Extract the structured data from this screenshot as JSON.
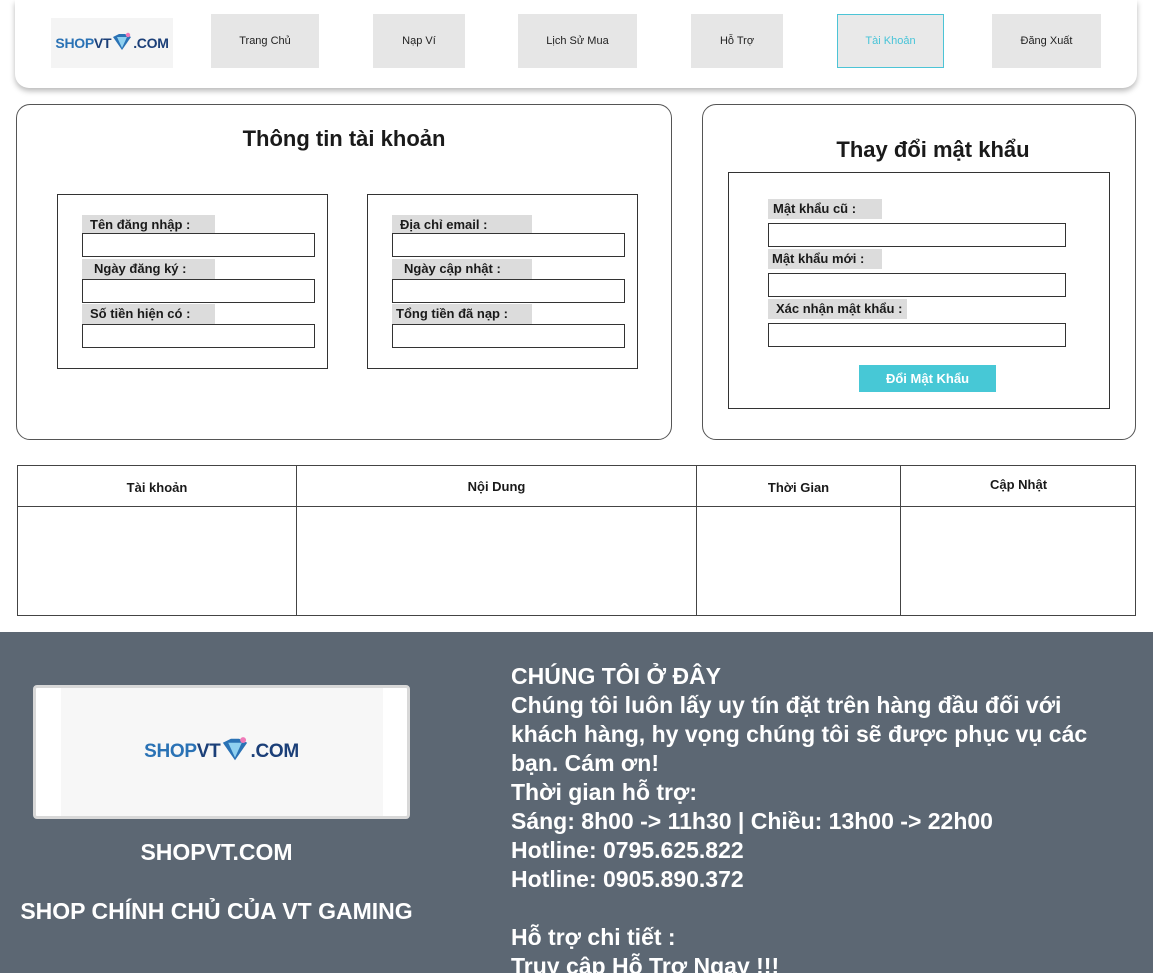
{
  "brand": {
    "logo_shop": "SHOP",
    "logo_vt": "VT",
    "logo_com": ".COM"
  },
  "nav": {
    "items": [
      {
        "label": "Trang Chủ"
      },
      {
        "label": "Nạp Ví"
      },
      {
        "label": "Lịch Sử Mua"
      },
      {
        "label": "Hỗ Trợ"
      },
      {
        "label": "Tài Khoản"
      },
      {
        "label": "Đăng Xuất"
      }
    ],
    "active": "Tài Khoản"
  },
  "account_info": {
    "title": "Thông tin tài khoản",
    "left_fields": [
      {
        "label": "Tên đăng nhập :",
        "value": ""
      },
      {
        "label": "Ngày đăng ký :",
        "value": ""
      },
      {
        "label": "Số tiền hiện có :",
        "value": ""
      }
    ],
    "right_fields": [
      {
        "label": "Địa chỉ email :",
        "value": ""
      },
      {
        "label": "Ngày cập nhật :",
        "value": ""
      },
      {
        "label": "Tổng tiền đã nạp :",
        "value": ""
      }
    ]
  },
  "change_password": {
    "title": "Thay đổi mật khẩu",
    "fields": [
      {
        "label": "Mật khẩu cũ :",
        "value": ""
      },
      {
        "label": "Mật khẩu mới :",
        "value": ""
      },
      {
        "label": "Xác nhận mật khẩu :",
        "value": ""
      }
    ],
    "button_label": "Đổi Mật Khẩu"
  },
  "history_table": {
    "columns": [
      "Tài khoản",
      "Nội Dung",
      "Thời Gian",
      "Cập Nhật"
    ],
    "rows": []
  },
  "footer": {
    "site_name": "SHOPVT.COM",
    "tagline": "SHOP CHÍNH CHỦ CỦA VT GAMING",
    "heading": "CHÚNG TÔI Ở ĐÂY",
    "intro": "Chúng tôi luôn lấy uy tín đặt trên hàng đầu đối với khách hàng, hy vọng chúng tôi sẽ được phục vụ các bạn. Cám ơn!",
    "hours_label": "Thời gian hỗ trợ:",
    "hours": "Sáng: 8h00 -> 11h30 | Chiều: 13h00 -> 22h00",
    "hotline_1": "Hotline: 0795.625.822",
    "hotline_2": "Hotline: 0905.890.372",
    "support_label": "Hỗ trợ chi tiết :",
    "access_prefix": "Truy cập ",
    "support_link": "Hỗ Trợ Ngay !!!"
  },
  "colors": {
    "accent": "#47c8d6",
    "footer_bg": "#5c6773",
    "logo_blue": "#2a72b5",
    "logo_navy": "#1b3f78"
  }
}
